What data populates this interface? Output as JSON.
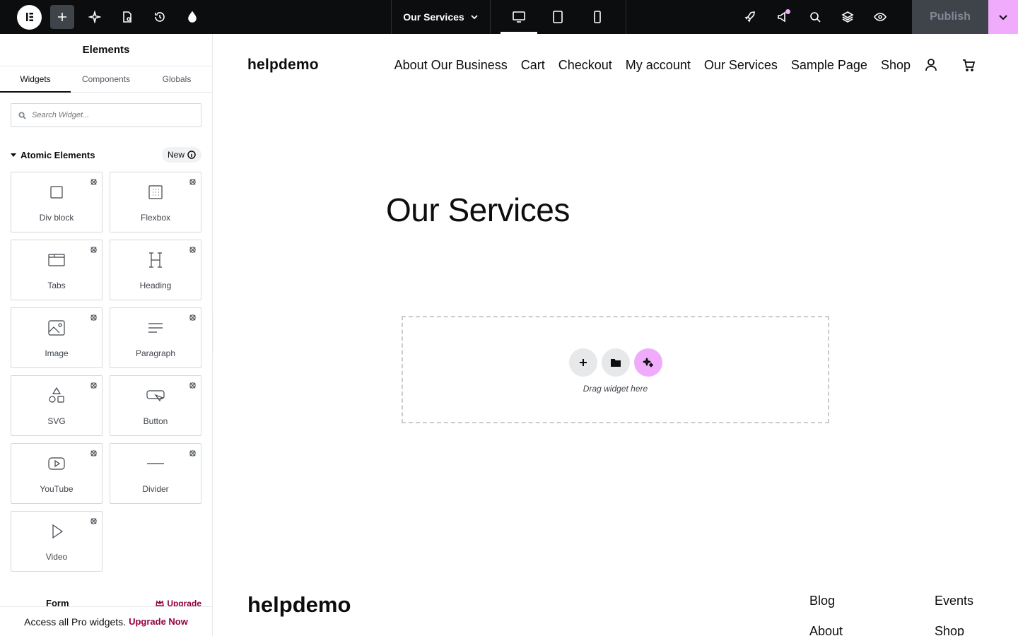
{
  "topbar": {
    "document_title": "Our Services",
    "publish_label": "Publish"
  },
  "panel": {
    "title": "Elements",
    "tabs": [
      "Widgets",
      "Components",
      "Globals"
    ],
    "search_placeholder": "Search Widget...",
    "section_title": "Atomic Elements",
    "section_badge": "New",
    "widgets": [
      {
        "label": "Div block",
        "icon": "div-block-icon"
      },
      {
        "label": "Flexbox",
        "icon": "flexbox-icon"
      },
      {
        "label": "Tabs",
        "icon": "tabs-icon"
      },
      {
        "label": "Heading",
        "icon": "heading-icon"
      },
      {
        "label": "Image",
        "icon": "image-icon"
      },
      {
        "label": "Paragraph",
        "icon": "paragraph-icon"
      },
      {
        "label": "SVG",
        "icon": "svg-icon"
      },
      {
        "label": "Button",
        "icon": "button-icon"
      },
      {
        "label": "YouTube",
        "icon": "youtube-icon"
      },
      {
        "label": "Divider",
        "icon": "divider-icon"
      },
      {
        "label": "Video",
        "icon": "video-icon"
      }
    ],
    "pro_section_title": "Form",
    "pro_upgrade": "Upgrade",
    "pro_banner_text": "Access all Pro widgets.",
    "pro_banner_link": "Upgrade Now"
  },
  "site": {
    "brand": "helpdemo",
    "nav": [
      "About Our Business",
      "Cart",
      "Checkout",
      "My account",
      "Our Services",
      "Sample Page",
      "Shop"
    ],
    "heading": "Our Services",
    "dropzone_label": "Drag widget here",
    "footer_brand": "helpdemo",
    "footer_col1": [
      "Blog",
      "About"
    ],
    "footer_col2": [
      "Events",
      "Shop"
    ]
  },
  "colors": {
    "accent": "#f0abfc",
    "topbar_bg": "#0c0d0e",
    "upgrade": "#93003f"
  }
}
